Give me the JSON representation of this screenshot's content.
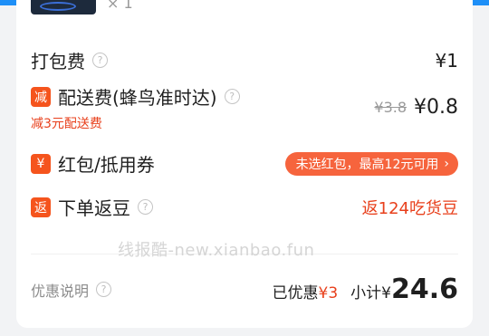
{
  "header": {
    "qty": "× 1"
  },
  "packaging": {
    "label": "打包费",
    "help": "?",
    "price": "¥1"
  },
  "delivery": {
    "badge": "减",
    "label": "配送费(蜂鸟准时达)",
    "help": "?",
    "original": "¥3.8",
    "price": "¥0.8",
    "discount_note": "减3元配送费"
  },
  "redpacket": {
    "badge": "¥",
    "label": "红包/抵用券",
    "pill_text": "未选红包，最高12元可用",
    "chevron": "›"
  },
  "beans": {
    "badge": "返",
    "label": "下单返豆",
    "help": "?",
    "value": "返124吃货豆"
  },
  "watermark": "线报酷-new.xianbao.fun",
  "footer": {
    "label": "优惠说明",
    "help": "?",
    "saved_label": "已优惠",
    "saved_amount": "¥3",
    "subtotal_label": "小计¥",
    "subtotal_value": "24.6"
  },
  "colors": {
    "accent_red": "#e8401c",
    "badge_orange": "#f5541d",
    "pill": "#f6643d",
    "top_bar": "#1e8ff7"
  }
}
